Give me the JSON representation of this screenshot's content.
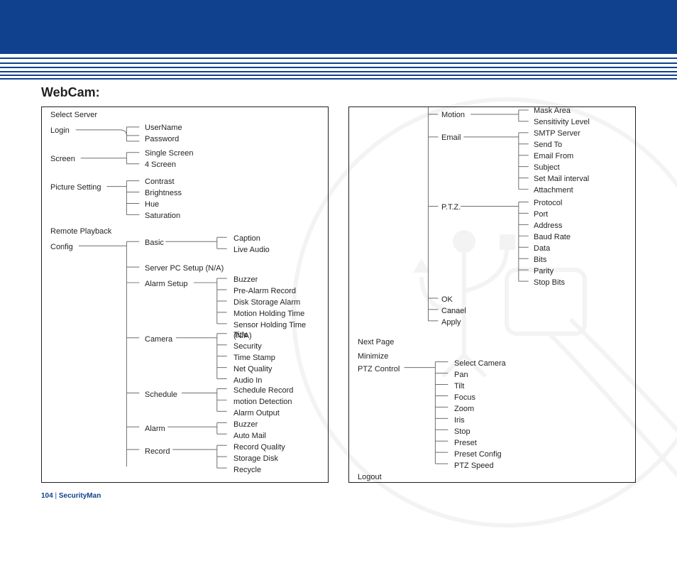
{
  "title": "WebCam:",
  "footer": {
    "page": "104",
    "sep": "  |  ",
    "brand": "SecurityMan"
  },
  "left": {
    "c0": {
      "select_server": "Select Server",
      "login": "Login",
      "screen": "Screen",
      "picture": "Picture Setting",
      "remote": "Remote Playback",
      "config": "Config"
    },
    "login": {
      "user": "UserName",
      "pass": "Password"
    },
    "screen": {
      "single": "Single Screen",
      "four": "4 Screen"
    },
    "picture": {
      "contrast": "Contrast",
      "brightness": "Brightness",
      "hue": "Hue",
      "saturation": "Saturation"
    },
    "config_c1": {
      "basic": "Basic",
      "serverpc": "Server PC Setup (N/A)",
      "alarmset": "Alarm Setup",
      "camera": "Camera",
      "schedule": "Schedule",
      "alarm": "Alarm",
      "record": "Record"
    },
    "basic": {
      "caption": "Caption",
      "live": "Live Audio"
    },
    "alarmset": {
      "buzzer": "Buzzer",
      "prealarm": "Pre-Alarm Record",
      "disk": "Disk Storage Alarm",
      "motion": "Motion Holding Time",
      "sensor": "Sensor Holding Time (N/A)"
    },
    "camera": {
      "title": "Title",
      "security": "Security",
      "ts": "Time Stamp",
      "netq": "Net Quality",
      "audioin": "Audio In"
    },
    "schedule": {
      "srec": "Schedule Record",
      "mdet": "motion Detection",
      "aout": "Alarm Output"
    },
    "alarm": {
      "buzzer": "Buzzer",
      "automail": "Auto Mail"
    },
    "record": {
      "rq": "Record Quality",
      "sd": "Storage Disk",
      "rc": "Recycle"
    }
  },
  "right": {
    "c1_top": {
      "motion": "Motion",
      "email": "Email",
      "ptz": "P.T.Z.",
      "ok": "OK",
      "cancel": "Canael",
      "apply": "Apply"
    },
    "motion": {
      "mask": "Mask Area",
      "sens": "Sensitivity Level"
    },
    "email": {
      "smtp": "SMTP Server",
      "sendto": "Send To",
      "from": "Email From",
      "subj": "Subject",
      "intv": "Set Mail interval",
      "att": "Attachment"
    },
    "ptz": {
      "proto": "Protocol",
      "port": "Port",
      "addr": "Address",
      "baud": "Baud Rate",
      "data": "Data",
      "bits": "Bits",
      "parity": "Parity",
      "stop": "Stop Bits"
    },
    "c0": {
      "next": "Next Page",
      "min": "Minimize",
      "ptzc": "PTZ Control",
      "logout": "Logout"
    },
    "ptzc": {
      "sel": "Select Camera",
      "pan": "Pan",
      "tilt": "Tilt",
      "focus": "Focus",
      "zoom": "Zoom",
      "iris": "Iris",
      "stop": "Stop",
      "preset": "Preset",
      "pcfg": "Preset Config",
      "speed": "PTZ Speed"
    }
  }
}
